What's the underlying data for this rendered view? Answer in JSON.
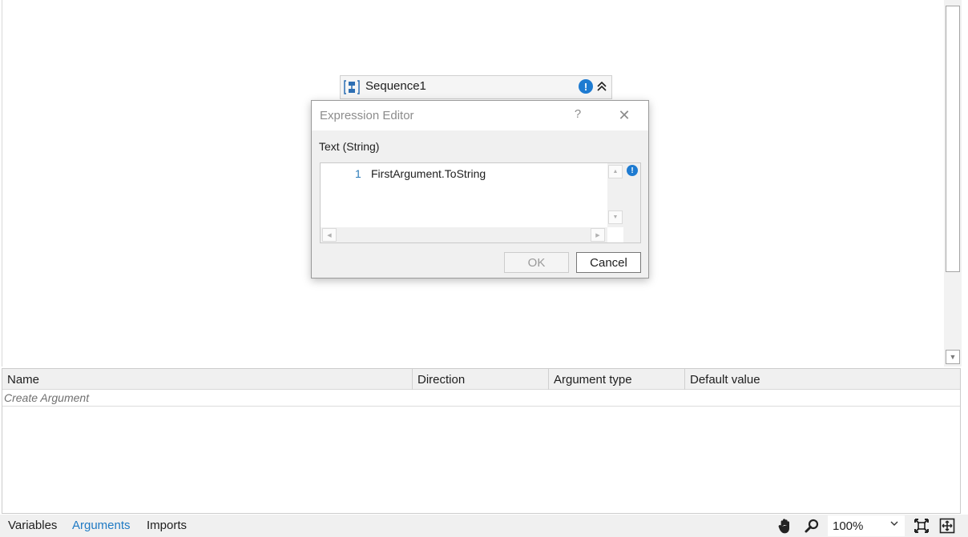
{
  "designer": {
    "sequence": {
      "title": "Sequence1",
      "icon": "sequence-icon",
      "warning_icon": "warning-icon",
      "collapse_icon": "double-chevron-up-icon"
    }
  },
  "dialog": {
    "title": "Expression Editor",
    "help": "?",
    "close": "✕",
    "label": "Text (String)",
    "line_number": "1",
    "expression": "FirstArgument.ToString",
    "ok_label": "OK",
    "cancel_label": "Cancel"
  },
  "arguments": {
    "columns": [
      "Name",
      "Direction",
      "Argument type",
      "Default value"
    ],
    "create_placeholder": "Create Argument"
  },
  "bottombar": {
    "tabs": [
      "Variables",
      "Arguments",
      "Imports"
    ],
    "active_tab": "Arguments",
    "zoom": "100%",
    "icons": [
      "hand-icon",
      "zoom-icon",
      "fit-to-screen-icon",
      "overview-icon"
    ]
  },
  "colors": {
    "accent": "#1f7ac4",
    "warning": "#1e7bd1"
  }
}
